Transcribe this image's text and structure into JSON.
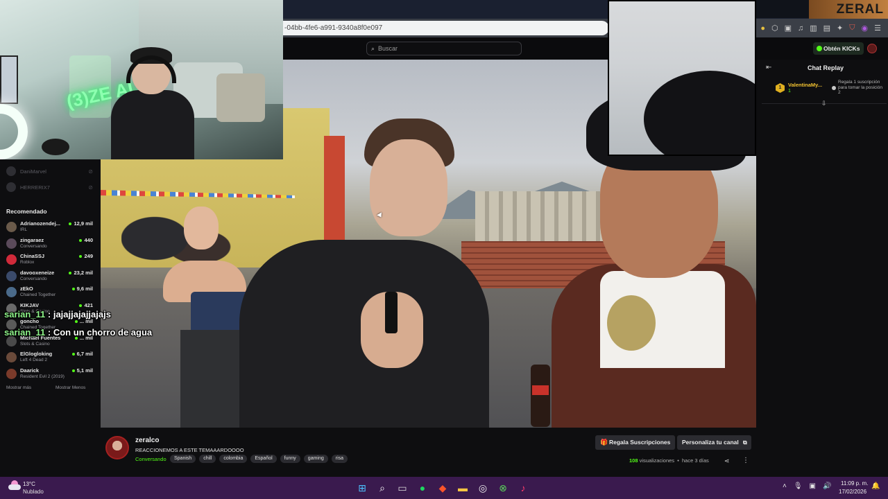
{
  "browser": {
    "url": "-04bb-4fe6-a991-9340a8f0e097",
    "toolbar_icons": [
      "search-icon",
      "share-icon",
      "brave-shield-icon",
      "rewards-icon"
    ],
    "extension_icons": [
      "extension-icon",
      "extension-icon",
      "extension-icon",
      "music-icon",
      "sidebar-icon",
      "wallet-icon",
      "shield-icon",
      "vpn-icon",
      "menu-icon"
    ]
  },
  "header": {
    "search_placeholder": "Buscar",
    "kicks_label": "Obtén KICKs"
  },
  "webcam": {
    "neon_text": "(3)ZE AL O"
  },
  "logo": {
    "text": "ZERAL"
  },
  "sidebar": {
    "followed": [
      {
        "name": "DaniMarvel"
      },
      {
        "name": "HERRERIX7"
      }
    ],
    "recommended_title": "Recomendado",
    "recommended": [
      {
        "name": "Adrianozendej...",
        "category": "IRL",
        "viewers": "12,9 mil",
        "color": "#6a5a4a"
      },
      {
        "name": "zingaraez",
        "category": "Conversando",
        "viewers": "440",
        "color": "#5a4a5a"
      },
      {
        "name": "ChinaSSJ",
        "category": "Roblox",
        "viewers": "249",
        "color": "#d02a3a"
      },
      {
        "name": "davooxeneize",
        "category": "Conversando",
        "viewers": "23,2 mil",
        "color": "#3a4a6a"
      },
      {
        "name": "zEkO",
        "category": "Chained Together",
        "viewers": "9,6 mil",
        "color": "#4a6a8a"
      },
      {
        "name": "KIKJAV",
        "category": "Slots & Casino",
        "viewers": "421",
        "color": "#6a6a6a"
      },
      {
        "name": "goncho",
        "category": "Chained Together",
        "viewers": "... mil",
        "color": "#5a5a5a"
      },
      {
        "name": "Michael Fuentes",
        "category": "Slots & Casino",
        "viewers": "... mil",
        "color": "#4a4a4a"
      },
      {
        "name": "ElGlogloking",
        "category": "Left 4 Dead 2",
        "viewers": "6,7 mil",
        "color": "#6a4a3a"
      },
      {
        "name": "Daarick",
        "category": "Resident Evil 2 (2019)",
        "viewers": "5,1 mil",
        "color": "#7a3a2a"
      }
    ],
    "show_more": "Mostrar más",
    "show_less": "Mostrar Menos"
  },
  "overlay_chat": [
    {
      "user": "sarian_11",
      "sep": " : ",
      "message": "jajajjajajjajajs"
    },
    {
      "user": "sarian_11",
      "sep": " : ",
      "message": "Con un chorro de agua"
    }
  ],
  "chat": {
    "title": "Chat Replay",
    "sub": {
      "badge": "1",
      "user": "ValentinaMy...",
      "count": "1",
      "gift_text": "Regala 1 suscripción para tomar la posición 2"
    }
  },
  "stream": {
    "channel": "zeralco",
    "title": "REACCIONEMOS A ESTE TEMAAARDOOOO",
    "category": "Conversando",
    "tags": [
      "Spanish",
      "chill",
      "colombia",
      "Español",
      "funny",
      "gaming",
      "risa"
    ],
    "gift_button": "Regala Suscripciones",
    "customize_button": "Personaliza tu canal",
    "views_count": "108",
    "views_label": " visualizaciones",
    "posted": "hace 3 días"
  },
  "taskbar": {
    "temperature": "13°C",
    "condition": "Nublado",
    "time": "11:09 p. m.",
    "date": "17/02/2026",
    "apps": [
      "windows-start-icon",
      "search-icon",
      "task-view-icon",
      "spotify-icon",
      "brave-icon",
      "file-explorer-icon",
      "obs-icon",
      "xbox-icon",
      "tiktok-icon"
    ]
  }
}
